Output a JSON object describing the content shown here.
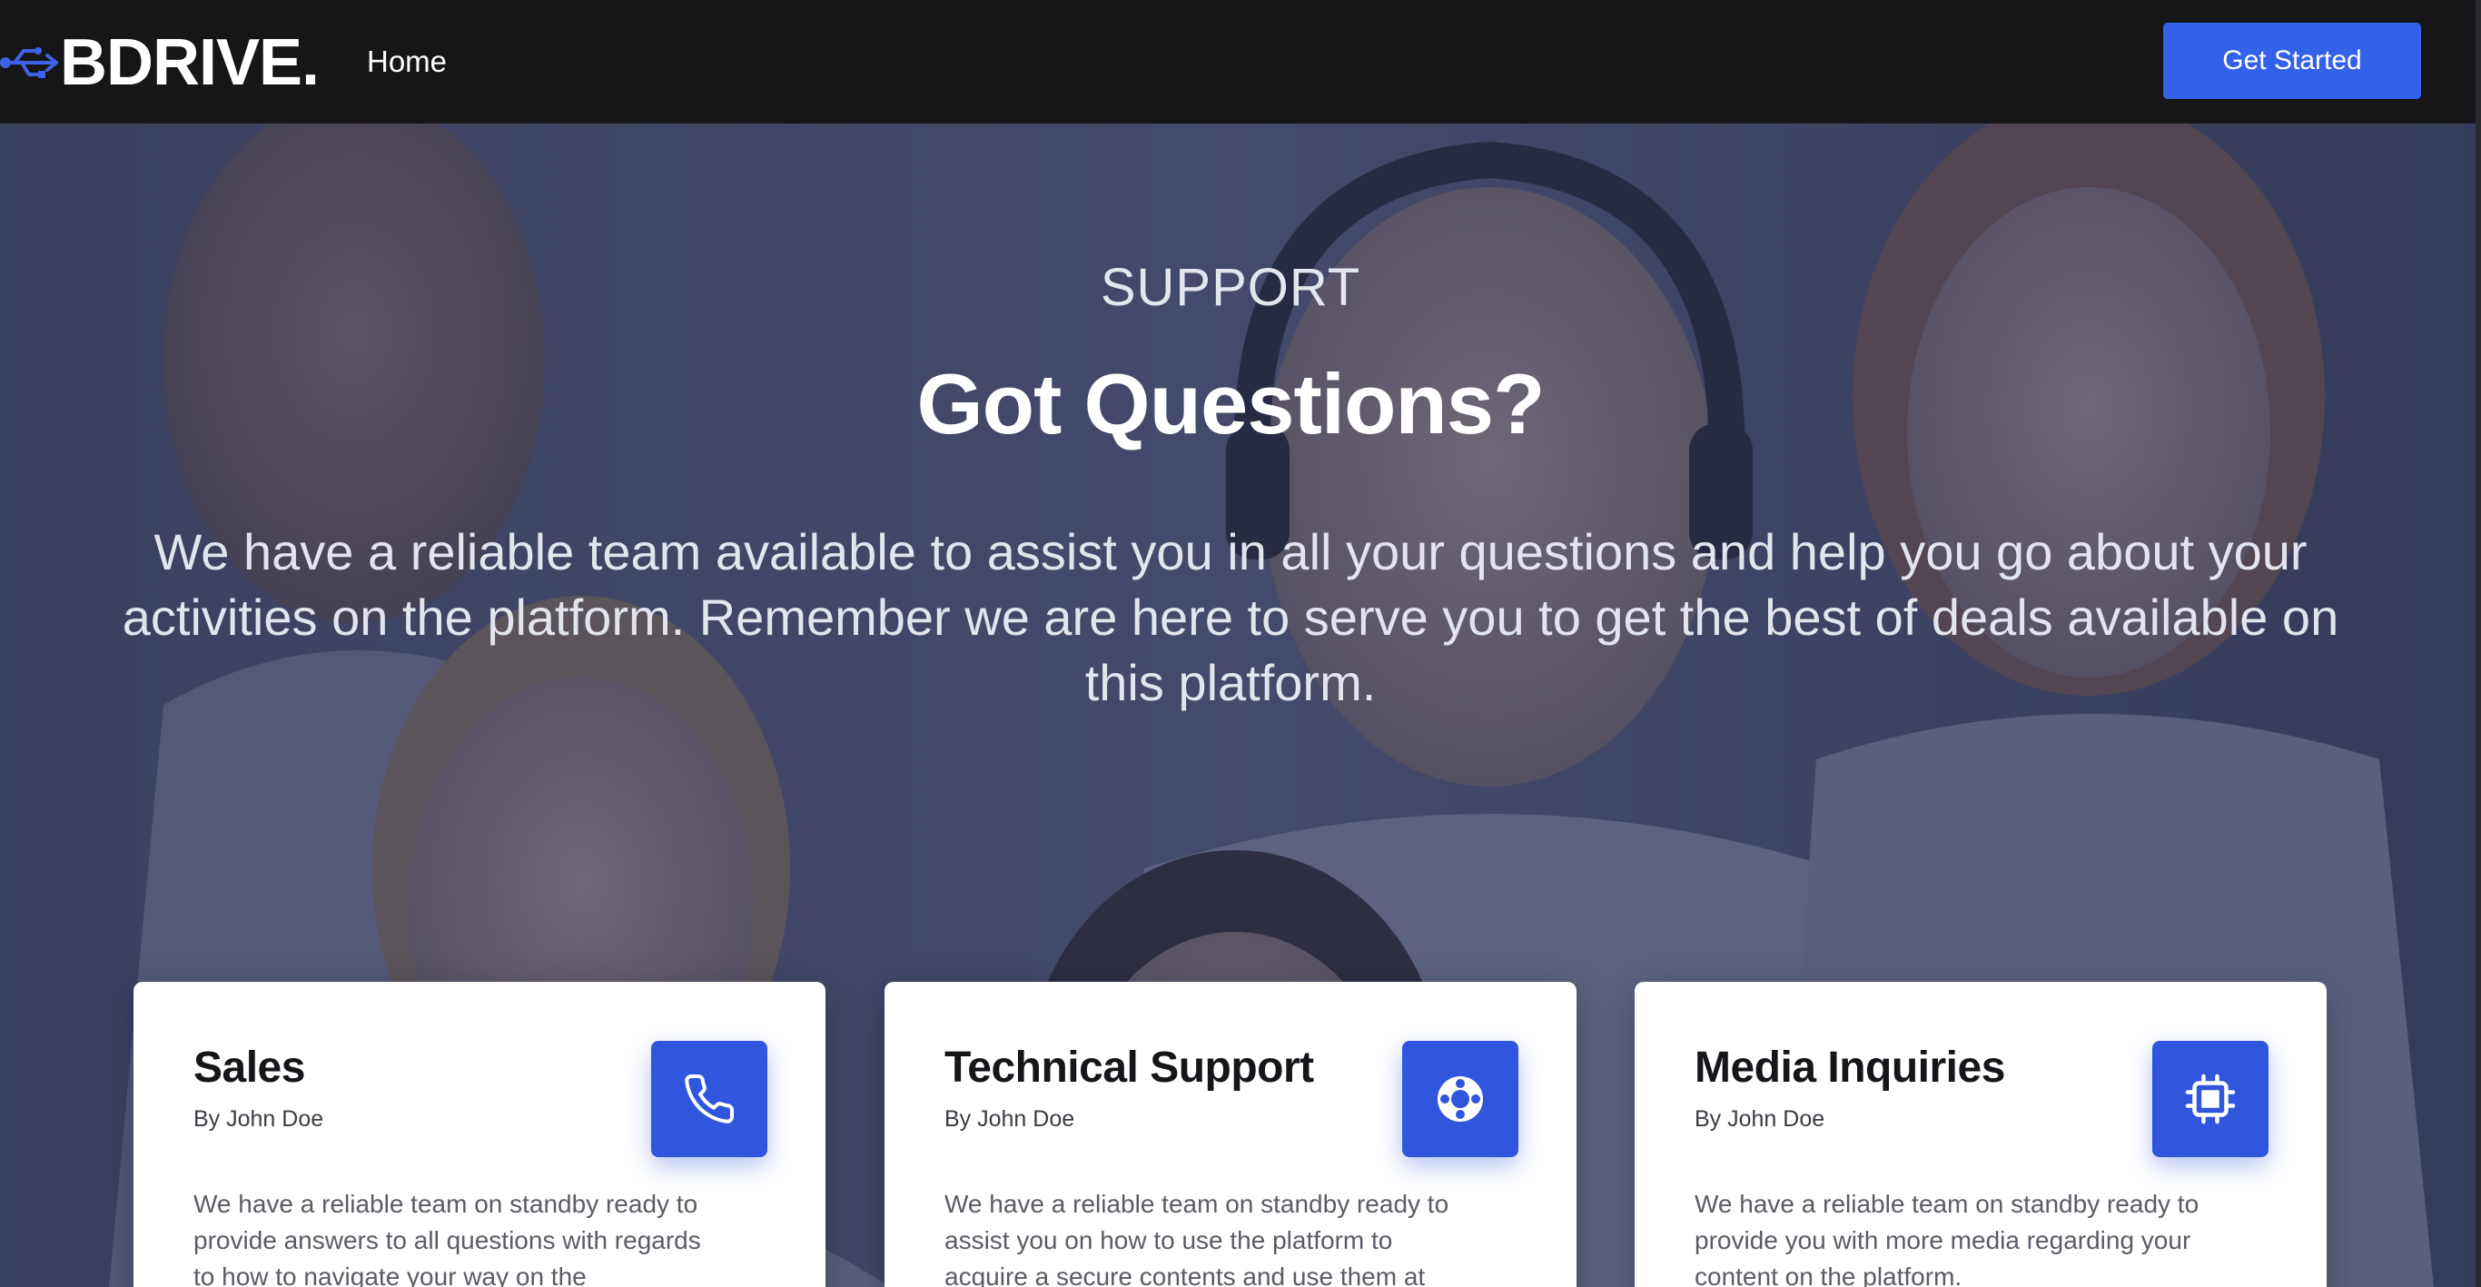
{
  "navbar": {
    "logo_text": "BDRIVE.",
    "logo_icon": "usb-icon",
    "home_label": "Home",
    "cta_label": "Get Started"
  },
  "hero": {
    "eyebrow": "SUPPORT",
    "title": "Got Questions?",
    "text": "We have a reliable team available to assist you in all your questions and help you go about your activities on the platform. Remember we are here to serve you to get the best of deals available on this platform."
  },
  "cards": [
    {
      "title": "Sales",
      "author": "By John Doe",
      "icon": "phone-icon",
      "text": "We have a reliable team on standby ready to provide answers to all questions with regards to how to navigate your way on the"
    },
    {
      "title": "Technical Support",
      "author": "By John Doe",
      "icon": "lifebuoy-icon",
      "text": "We have a reliable team on standby ready to assist you on how to use the platform to acquire a secure contents and use them at"
    },
    {
      "title": "Media Inquiries",
      "author": "By John Doe",
      "icon": "cpu-chip-icon",
      "text": "We have a reliable team on standby ready to provide you with more media regarding your content on the platform."
    }
  ],
  "colors": {
    "navbar_bg": "#161618",
    "accent": "#3461ea",
    "icon_tile": "#2f56dd",
    "hero_overlay": "#22284e"
  }
}
